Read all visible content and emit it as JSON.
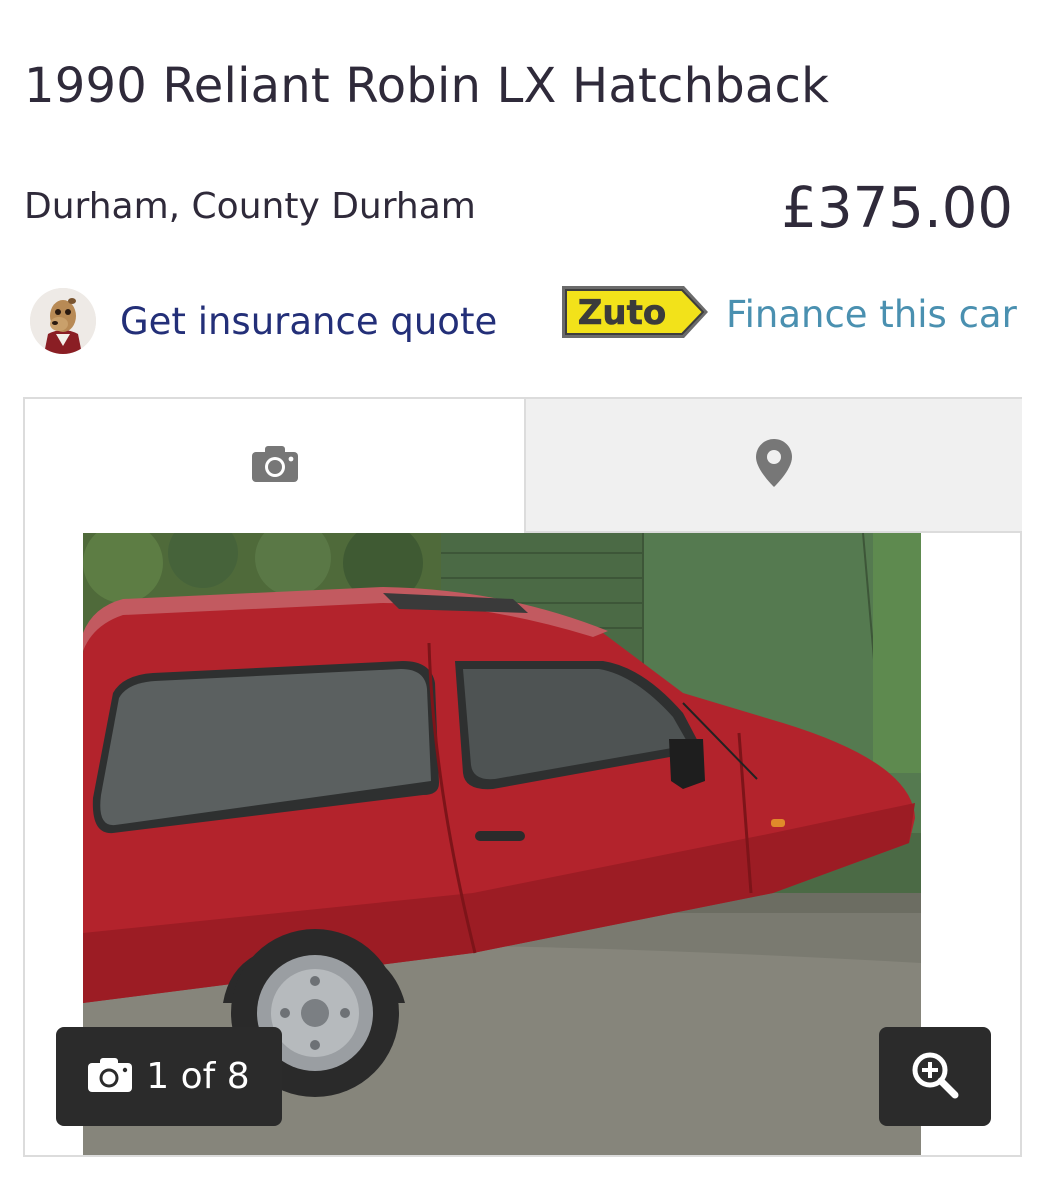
{
  "listing": {
    "title": "1990 Reliant Robin LX Hatchback",
    "location": "Durham, County Durham",
    "price": "£375.00"
  },
  "actions": {
    "insurance_label": "Get insurance quote",
    "finance_brand": "Zuto",
    "finance_label": "Finance this car"
  },
  "gallery": {
    "tabs": [
      {
        "icon": "camera-icon"
      },
      {
        "icon": "map-pin-icon"
      }
    ],
    "counter": "1 of 8",
    "zoom_icon": "zoom-in-icon"
  },
  "colors": {
    "text": "#2f2a3a",
    "insurance_link": "#232f78",
    "finance_link": "#4a90b0",
    "zuto_yellow": "#f2e21a",
    "overlay": "#2b2b2b"
  }
}
